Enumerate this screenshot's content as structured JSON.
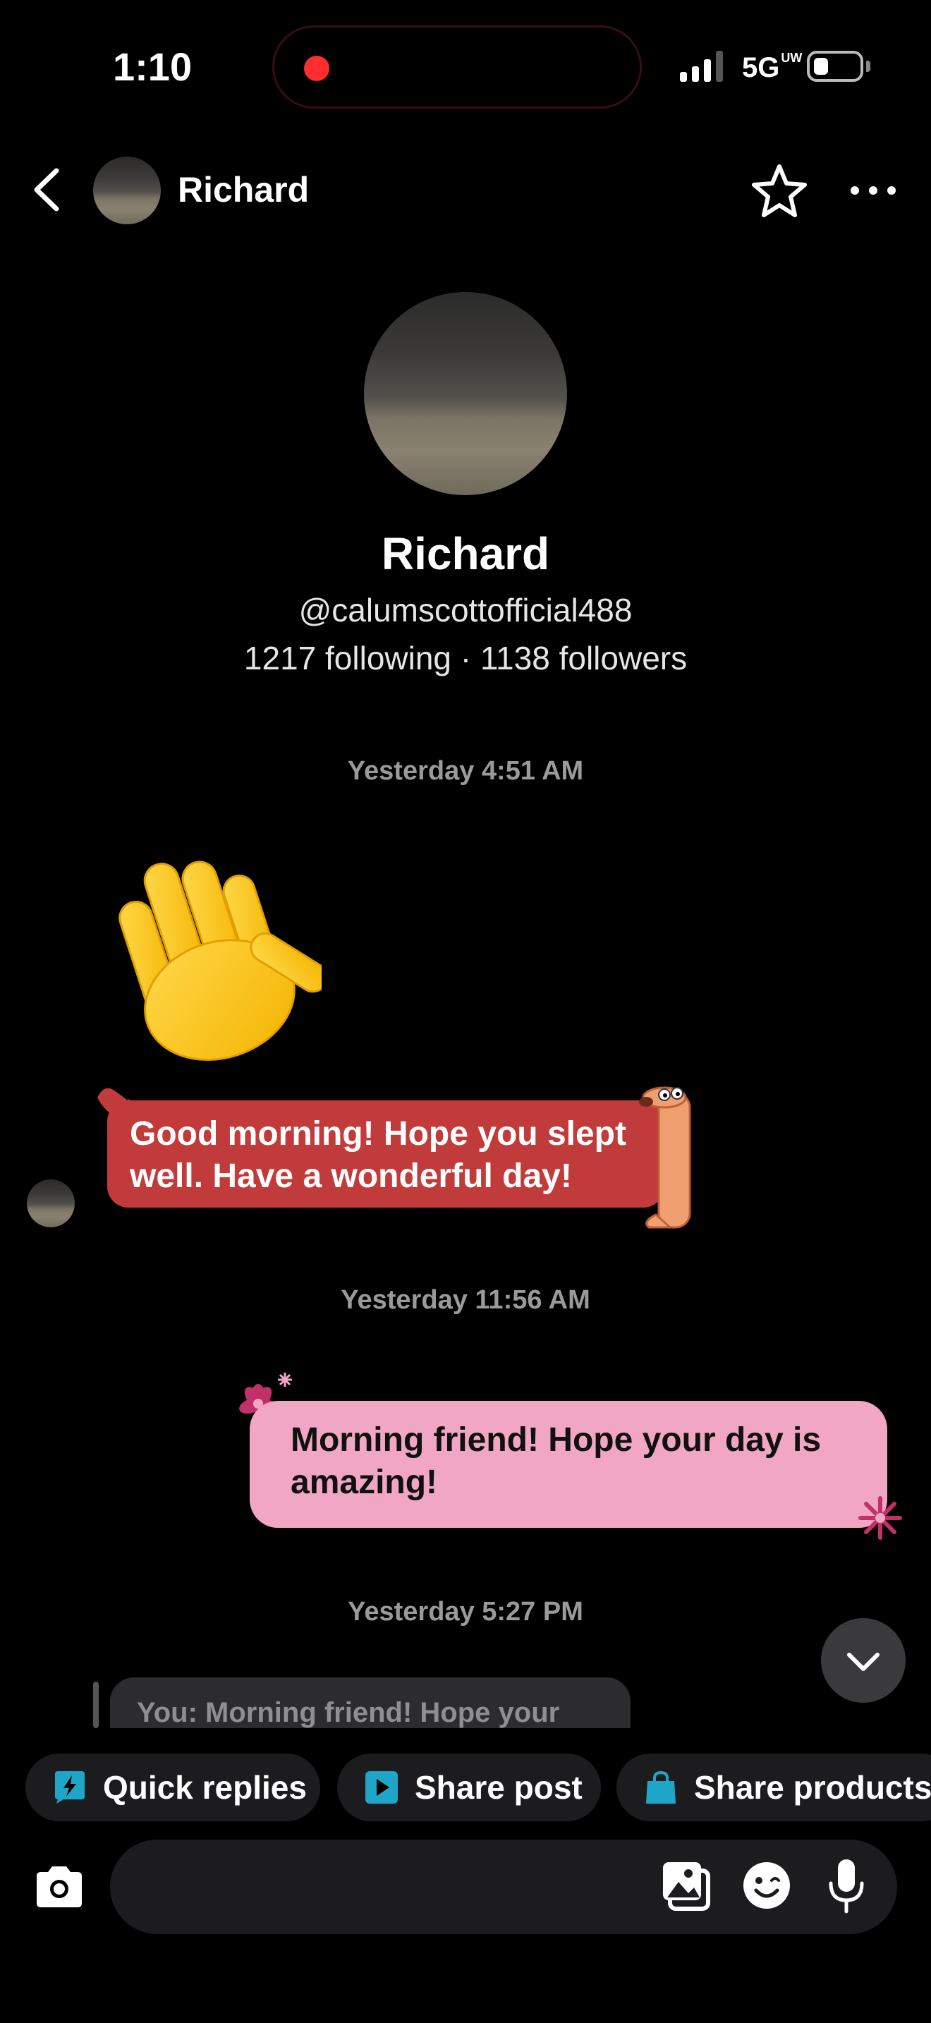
{
  "status_bar": {
    "time": "1:10",
    "network": "5G",
    "network_suffix": "UW",
    "recording": true,
    "battery_level": 0.2
  },
  "header": {
    "contact_name": "Richard",
    "icons": [
      "back-arrow-icon",
      "star-icon",
      "more-icon"
    ]
  },
  "profile": {
    "name": "Richard",
    "handle": "@calumscottofficial488",
    "stats": "1217 following · 1138 followers"
  },
  "conversation": {
    "timestamps": [
      "Yesterday 4:51 AM",
      "Yesterday 11:56 AM",
      "Yesterday 5:27 PM"
    ],
    "received_emoji": "wave",
    "received_text": "Good morning! Hope you slept well. Have a wonderful day!",
    "sent_text": "Morning friend! Hope your day is amazing!",
    "reply_preview": "You: Morning friend! Hope your"
  },
  "quick_actions": {
    "chips": [
      "Quick replies",
      "Share post",
      "Share products"
    ]
  },
  "colors": {
    "background": "#000000",
    "received_bubble": "#c23b3b",
    "sent_bubble": "#f0a6c4",
    "chip_icon": "#1ea5c8",
    "recording": "#ff2d2d"
  }
}
